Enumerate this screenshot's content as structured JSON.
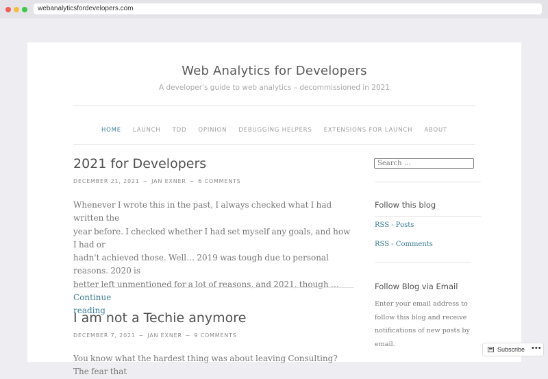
{
  "browser": {
    "url": "webanalyticsfordevelopers.com"
  },
  "site": {
    "title": "Web Analytics for Developers",
    "description": "A developer's guide to web analytics – decommissioned in 2021"
  },
  "nav": {
    "items": [
      {
        "label": "HOME",
        "active": true
      },
      {
        "label": "LAUNCH"
      },
      {
        "label": "TDD"
      },
      {
        "label": "OPINION"
      },
      {
        "label": "DEBUGGING HELPERS"
      },
      {
        "label": "EXTENSIONS FOR LAUNCH"
      },
      {
        "label": "ABOUT"
      }
    ]
  },
  "posts": [
    {
      "title": "2021 for Developers",
      "date": "DECEMBER 21, 2021",
      "author": "JAN EXNER",
      "comments": "6 COMMENTS",
      "separator": "~",
      "excerpt_lines": [
        "Whenever I wrote this in the past, I always checked what I had written the",
        "year before. I checked whether I had set myself any goals, and how I had or",
        "hadn't achieved those. Well… 2019 was tough due to personal reasons. 2020 is",
        "better left unmentioned for a lot of reasons, and 2021, though … "
      ],
      "continue_label": "Continue",
      "continue_label_2": "reading"
    },
    {
      "title": "I am not a Techie anymore",
      "date": "DECEMBER 7, 2021",
      "author": "JAN EXNER",
      "comments": "9 COMMENTS",
      "separator": "~",
      "excerpt_lines": [
        "You know what the hardest thing was about leaving Consulting? The fear that"
      ]
    }
  ],
  "sidebar": {
    "search_placeholder": "Search …",
    "follow_title": "Follow this blog",
    "rss_posts": "RSS - Posts",
    "rss_comments": "RSS - Comments",
    "email_title": "Follow Blog via Email",
    "email_text_lines": [
      "Enter your email address to",
      "follow this blog and receive",
      "notifications of new posts by",
      "email."
    ]
  },
  "actionbar": {
    "subscribe_label": "Subscribe",
    "more_label": "•••"
  }
}
